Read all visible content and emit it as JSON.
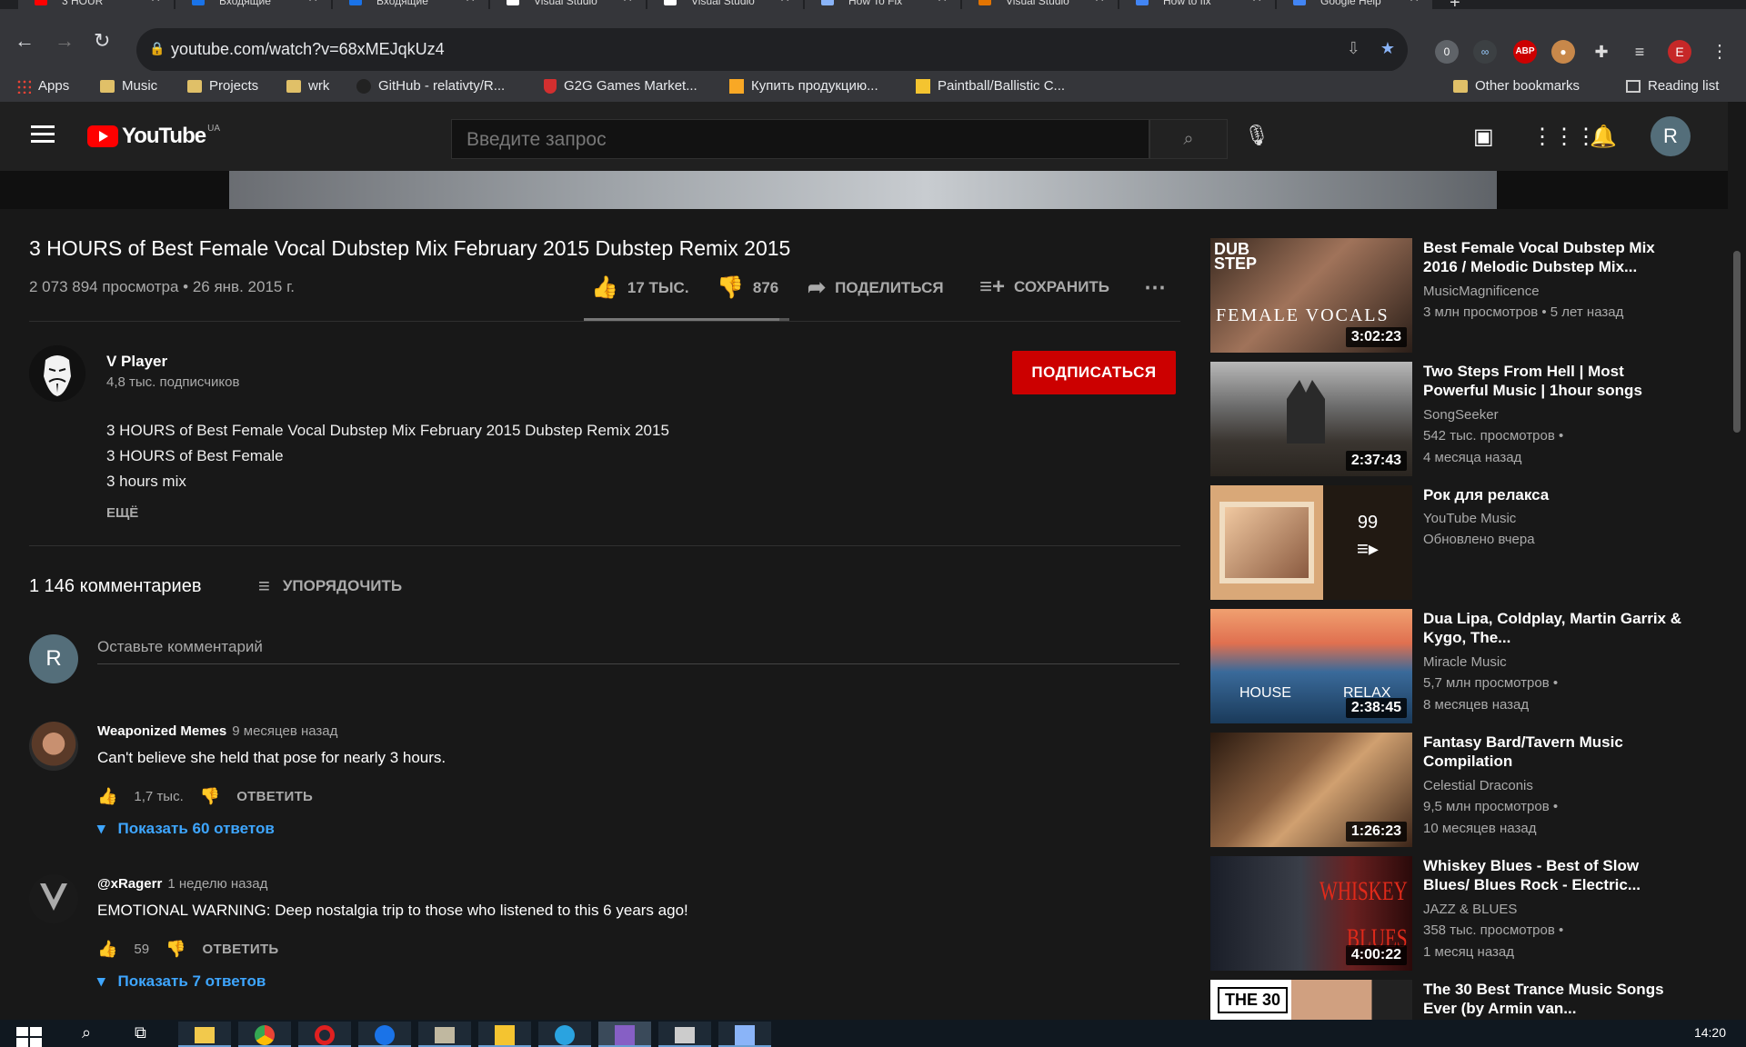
{
  "browser": {
    "tabs": [
      {
        "label": "3 HOUR",
        "color": "#ff0000"
      },
      {
        "label": "Входящие",
        "color": "#1a73e8"
      },
      {
        "label": "Входящие",
        "color": "#1a73e8"
      },
      {
        "label": "Visual Studio",
        "color": "#ffffff"
      },
      {
        "label": "Visual Studio",
        "color": "#ffffff"
      },
      {
        "label": "How To Fix",
        "color": "#8ab4f8"
      },
      {
        "label": "Visual Studio",
        "color": "#e37400"
      },
      {
        "label": "How to fix",
        "color": "#4285f4"
      },
      {
        "label": "Google Help",
        "color": "#4285f4"
      }
    ],
    "url": "youtube.com/watch?v=68xMEJqkUz4",
    "ext_badge": "0",
    "ext_abp": "ABP",
    "profile_initial": "E",
    "bookmarks": [
      {
        "label": "Apps",
        "icon": "apps-grid-icon"
      },
      {
        "label": "Music",
        "icon": "folder-icon"
      },
      {
        "label": "Projects",
        "icon": "folder-icon"
      },
      {
        "label": "wrk",
        "icon": "folder-icon"
      },
      {
        "label": "GitHub - relativty/R...",
        "icon": "github-icon"
      },
      {
        "label": "G2G Games Market...",
        "icon": "g2g-icon"
      },
      {
        "label": "Купить продукцию...",
        "icon": "shop-icon"
      },
      {
        "label": "Paintball/Ballistic C...",
        "icon": "paintball-icon"
      }
    ],
    "other_bookmarks": "Other bookmarks",
    "reading_list": "Reading list"
  },
  "youtube": {
    "logo_text": "YouTube",
    "country": "UA",
    "search_placeholder": "Введите запрос",
    "avatar_initial": "R"
  },
  "video": {
    "title": "3 HOURS of Best Female Vocal Dubstep Mix February 2015 Dubstep Remix 2015",
    "meta": "2 073 894 просмотра • 26 янв. 2015 г.",
    "likes": "17 ТЫС.",
    "dislikes": "876",
    "share": "ПОДЕЛИТЬСЯ",
    "save": "СОХРАНИТЬ",
    "like_ratio": 0.95,
    "channel": {
      "name": "V Player",
      "subs": "4,8 тыс. подписчиков",
      "subscribe": "ПОДПИСАТЬСЯ"
    },
    "description": [
      "3 HOURS of Best Female Vocal Dubstep Mix February 2015   Dubstep Remix 2015",
      "3 HOURS of Best Female",
      "3 hours mix"
    ],
    "more": "ЕЩЁ"
  },
  "comments": {
    "count": "1 146 комментариев",
    "sort": "УПОРЯДОЧИТЬ",
    "add_placeholder": "Оставьте комментарий",
    "my_initial": "R",
    "reply_label": "ОТВЕТИТЬ",
    "items": [
      {
        "author": "Weaponized Memes",
        "time": "9 месяцев назад",
        "text": "Can't believe she held that pose for nearly 3 hours.",
        "likes": "1,7 тыс.",
        "replies": "Показать 60 ответов"
      },
      {
        "author": "@xRagerr",
        "time": "1 неделю назад",
        "text": "EMOTIONAL WARNING: Deep nostalgia trip to those who listened to this 6 years ago!",
        "likes": "59",
        "replies": "Показать 7 ответов"
      }
    ]
  },
  "sidebar": {
    "items": [
      {
        "title": "Best Female Vocal Dubstep Mix 2016 / Melodic Dubstep Mix...",
        "channel": "MusicMagnificence",
        "views": "3 млн просмотров • 5 лет назад",
        "duration": "3:02:23",
        "thumb_text": "FEMALE VOCALS",
        "thumb_label": "DUB STEP"
      },
      {
        "title": "Two Steps From Hell | Most Powerful Music | 1hour songs",
        "channel": "SongSeeker",
        "views": "542 тыс. просмотров •",
        "views2": "4 месяца назад",
        "duration": "2:37:43"
      },
      {
        "title": "Рок для релакса",
        "channel": "YouTube Music",
        "views": "Обновлено вчера",
        "playlist_count": "99"
      },
      {
        "title": "Dua Lipa, Coldplay, Martin Garrix & Kygo, The...",
        "channel": "Miracle Music",
        "views": "5,7 млн просмотров •",
        "views2": "8 месяцев назад",
        "duration": "2:38:45",
        "thumb_text": "HOUSE",
        "thumb_text2": "RELAX"
      },
      {
        "title": "Fantasy Bard/Tavern Music Compilation",
        "channel": "Celestial Draconis",
        "views": "9,5 млн просмотров •",
        "views2": "10 месяцев назад",
        "duration": "1:26:23"
      },
      {
        "title": "Whiskey Blues - Best of Slow Blues/ Blues Rock - Electric...",
        "channel": "JAZZ & BLUES",
        "views": "358 тыс. просмотров •",
        "views2": "1 месяц назад",
        "duration": "4:00:22",
        "thumb_text": "WHISKEY",
        "thumb_text2": "BLUES"
      },
      {
        "title": "The 30 Best Trance Music Songs Ever (by Armin van...",
        "thumb_text": "THE 30"
      }
    ]
  },
  "taskbar": {
    "clock": "14:20"
  }
}
